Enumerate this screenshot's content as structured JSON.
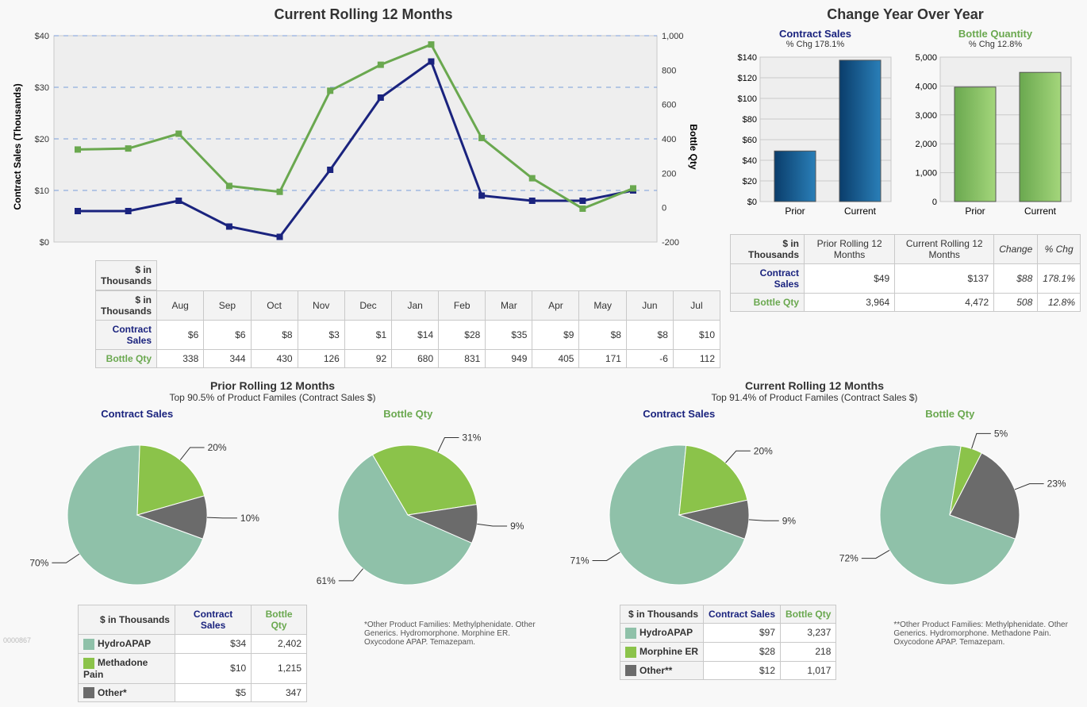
{
  "chart_data": [
    {
      "id": "rolling12",
      "type": "line",
      "title": "Current Rolling 12 Months",
      "categories": [
        "Aug",
        "Sep",
        "Oct",
        "Nov",
        "Dec",
        "Jan",
        "Feb",
        "Mar",
        "Apr",
        "May",
        "Jun",
        "Jul"
      ],
      "series": [
        {
          "name": "Contract Sales",
          "axis": "left",
          "values": [
            6,
            6,
            8,
            3,
            1,
            14,
            28,
            35,
            9,
            8,
            8,
            10
          ]
        },
        {
          "name": "Bottle Qty",
          "axis": "right",
          "values": [
            338,
            344,
            430,
            126,
            92,
            680,
            831,
            949,
            405,
            171,
            -6,
            112
          ]
        }
      ],
      "ylabel_left": "Contract Sales (Thousands)",
      "ylabel_right": "Bottle Qty",
      "ylim_left": [
        0,
        40
      ],
      "ylim_right": [
        -200,
        1000
      ],
      "grid": true
    },
    {
      "id": "yoy_sales",
      "type": "bar",
      "title": "Contract Sales",
      "subtitle": "% Chg 178.1%",
      "categories": [
        "Prior",
        "Current"
      ],
      "values": [
        49,
        137
      ],
      "ylim": [
        0,
        140
      ],
      "yprefix": "$"
    },
    {
      "id": "yoy_qty",
      "type": "bar",
      "title": "Bottle Quantity",
      "subtitle": "% Chg 12.8%",
      "categories": [
        "Prior",
        "Current"
      ],
      "values": [
        3964,
        4472
      ],
      "ylim": [
        0,
        5000
      ]
    },
    {
      "id": "prior_sales_pie",
      "type": "pie",
      "title": "Contract Sales",
      "slices": [
        {
          "name": "HydroAPAP",
          "value": 70
        },
        {
          "name": "Methadone Pain",
          "value": 20
        },
        {
          "name": "Other*",
          "value": 10
        }
      ]
    },
    {
      "id": "prior_qty_pie",
      "type": "pie",
      "title": "Bottle Qty",
      "slices": [
        {
          "name": "HydroAPAP",
          "value": 61
        },
        {
          "name": "Methadone Pain",
          "value": 31
        },
        {
          "name": "Other*",
          "value": 9
        }
      ]
    },
    {
      "id": "curr_sales_pie",
      "type": "pie",
      "title": "Contract Sales",
      "slices": [
        {
          "name": "HydroAPAP",
          "value": 71
        },
        {
          "name": "Morphine ER",
          "value": 20
        },
        {
          "name": "Other**",
          "value": 9
        }
      ]
    },
    {
      "id": "curr_qty_pie",
      "type": "pie",
      "title": "Bottle Qty",
      "slices": [
        {
          "name": "HydroAPAP",
          "value": 72
        },
        {
          "name": "Morphine ER",
          "value": 5
        },
        {
          "name": "Other**",
          "value": 23
        }
      ]
    }
  ],
  "rolling": {
    "title": "Current Rolling 12 Months",
    "table_header": "$ in Thousands",
    "row_sales": "Contract Sales",
    "row_qty": "Bottle Qty",
    "months": [
      "Aug",
      "Sep",
      "Oct",
      "Nov",
      "Dec",
      "Jan",
      "Feb",
      "Mar",
      "Apr",
      "May",
      "Jun",
      "Jul"
    ],
    "sales": [
      "$6",
      "$6",
      "$8",
      "$3",
      "$1",
      "$14",
      "$28",
      "$35",
      "$9",
      "$8",
      "$8",
      "$10"
    ],
    "qty": [
      "338",
      "344",
      "430",
      "126",
      "92",
      "680",
      "831",
      "949",
      "405",
      "171",
      "-6",
      "112"
    ],
    "left_ticks": [
      "$0",
      "$10",
      "$20",
      "$30",
      "$40"
    ],
    "right_ticks": [
      "-200",
      "0",
      "200",
      "400",
      "600",
      "800",
      "1,000"
    ],
    "ylabel_left": "Contract Sales (Thousands)",
    "ylabel_right": "Bottle Qty"
  },
  "yoy": {
    "title": "Change Year Over Year",
    "sales": {
      "title": "Contract Sales",
      "sub": "% Chg 178.1%",
      "cats": [
        "Prior",
        "Current"
      ],
      "ticks": [
        "$0",
        "$20",
        "$40",
        "$60",
        "$80",
        "$100",
        "$120",
        "$140"
      ]
    },
    "qty": {
      "title": "Bottle Quantity",
      "sub": "% Chg 12.8%",
      "cats": [
        "Prior",
        "Current"
      ],
      "ticks": [
        "0",
        "1,000",
        "2,000",
        "3,000",
        "4,000",
        "5,000"
      ]
    },
    "table": {
      "header": "$ in Thousands",
      "cols": [
        "Prior Rolling 12 Months",
        "Current Rolling 12 Months",
        "Change",
        "% Chg"
      ],
      "row_sales": "Contract Sales",
      "row_qty": "Bottle Qty",
      "sales": [
        "$49",
        "$137",
        "$88",
        "178.1%"
      ],
      "qty": [
        "3,964",
        "4,472",
        "508",
        "12.8%"
      ]
    }
  },
  "prior": {
    "title": "Prior Rolling 12 Months",
    "sub": "Top 90.5% of Product Familes (Contract Sales $)",
    "sales_title": "Contract Sales",
    "qty_title": "Bottle Qty",
    "table": {
      "header": "$ in Thousands",
      "col_sales": "Contract Sales",
      "col_qty": "Bottle Qty",
      "rows": [
        {
          "name": "HydroAPAP",
          "sales": "$34",
          "qty": "2,402",
          "color": "#8fc1a9"
        },
        {
          "name": "Methadone Pain",
          "sales": "$10",
          "qty": "1,215",
          "color": "#8bc34a"
        },
        {
          "name": "Other*",
          "sales": "$5",
          "qty": "347",
          "color": "#6b6b6b"
        }
      ]
    },
    "footnote": "*Other Product Families: Methylphenidate. Other Generics. Hydromorphone. Morphine ER. Oxycodone APAP. Temazepam."
  },
  "current": {
    "title": "Current Rolling 12 Months",
    "sub": "Top 91.4% of Product Familes (Contract Sales $)",
    "sales_title": "Contract Sales",
    "qty_title": "Bottle Qty",
    "table": {
      "header": "$ in Thousands",
      "col_sales": "Contract Sales",
      "col_qty": "Bottle Qty",
      "rows": [
        {
          "name": "HydroAPAP",
          "sales": "$97",
          "qty": "3,237",
          "color": "#8fc1a9"
        },
        {
          "name": "Morphine ER",
          "sales": "$28",
          "qty": "218",
          "color": "#8bc34a"
        },
        {
          "name": "Other**",
          "sales": "$12",
          "qty": "1,017",
          "color": "#6b6b6b"
        }
      ]
    },
    "footnote": "**Other Product Families: Methylphenidate. Other Generics. Hydromorphone. Methadone Pain. Oxycodone APAP. Temazepam."
  },
  "page_id": "0000867"
}
